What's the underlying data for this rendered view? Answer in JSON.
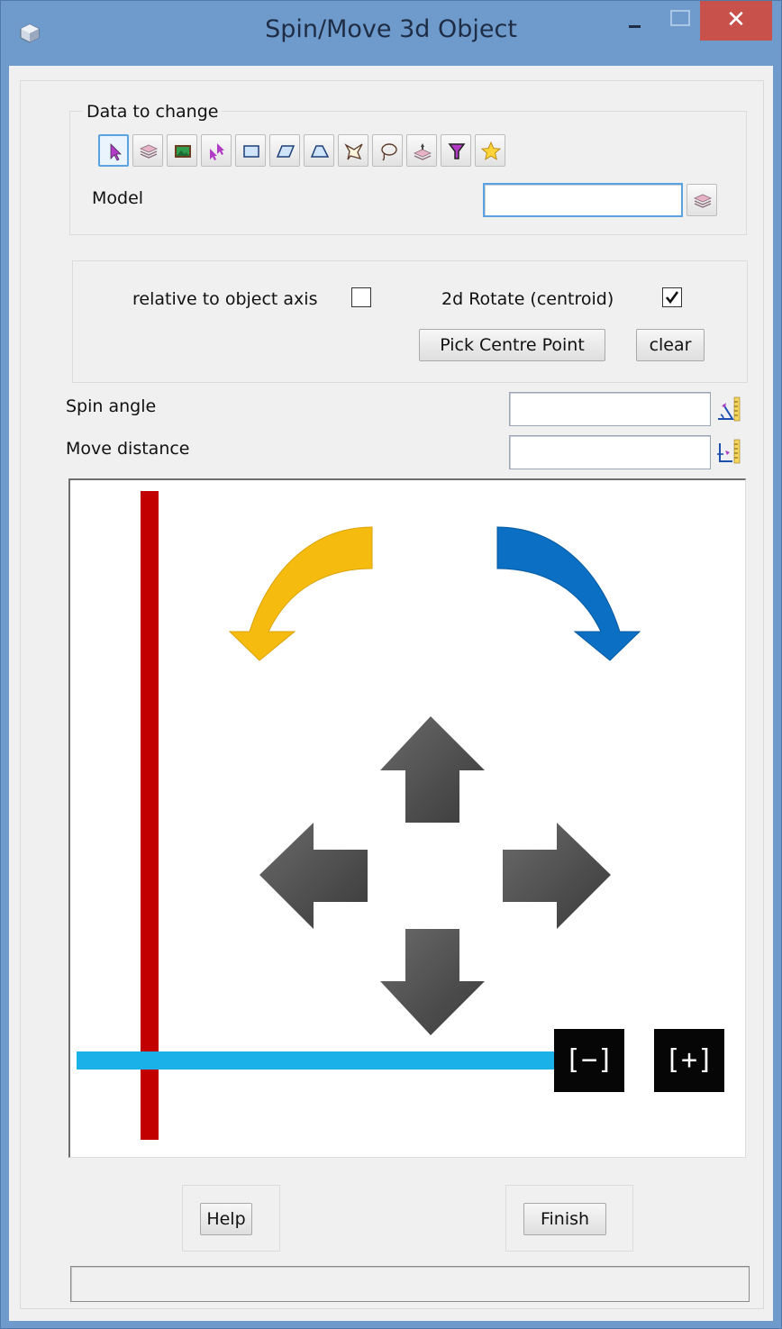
{
  "window": {
    "title": "Spin/Move 3d Object",
    "close_symbol": "✕",
    "icons": {
      "app": "cube-app-icon",
      "minimize": "minimize-icon",
      "maximize": "maximize-icon",
      "close": "close-icon"
    },
    "colors": {
      "titlebar": "#6f9bcc",
      "close": "#c9514c",
      "client": "#f0f0f0"
    }
  },
  "data_group": {
    "legend": "Data to change",
    "tools": [
      {
        "name": "select-pointer-icon",
        "selected": true
      },
      {
        "name": "model-layers-icon",
        "selected": false
      },
      {
        "name": "view-image-icon",
        "selected": false
      },
      {
        "name": "multi-select-icon",
        "selected": false
      },
      {
        "name": "rectangle-icon",
        "selected": false
      },
      {
        "name": "parallelogram-icon",
        "selected": false
      },
      {
        "name": "polygon-icon",
        "selected": false
      },
      {
        "name": "fence-icon",
        "selected": false
      },
      {
        "name": "lasso-icon",
        "selected": false
      },
      {
        "name": "layer-stack-icon",
        "selected": false
      },
      {
        "name": "filter-icon",
        "selected": false
      },
      {
        "name": "favourite-star-icon",
        "selected": false
      }
    ],
    "model_label": "Model",
    "model_value": "",
    "model_picker_icon": "model-layers-icon"
  },
  "options": {
    "relative_label": "relative to object axis",
    "relative_checked": false,
    "rotate_label": "2d Rotate (centroid)",
    "rotate_checked": true,
    "pick_centre_label": "Pick Centre Point",
    "clear_label": "clear"
  },
  "inputs": {
    "spin_label": "Spin angle",
    "spin_value": "",
    "spin_picker_icon": "angle-pick-icon",
    "move_label": "Move distance",
    "move_value": "",
    "move_picker_icon": "distance-pick-icon"
  },
  "canvas": {
    "zoom_out_label": "[−]",
    "zoom_in_label": "[+]",
    "colors": {
      "rotate_ccw": "#f5bc0f",
      "rotate_cw": "#0b6fc4",
      "move_arrows": "#4b4b4b",
      "vertical_axis": "#c20000",
      "horizontal_axis": "#1ab1e8"
    }
  },
  "footer": {
    "help_label": "Help",
    "finish_label": "Finish",
    "status_text": ""
  }
}
